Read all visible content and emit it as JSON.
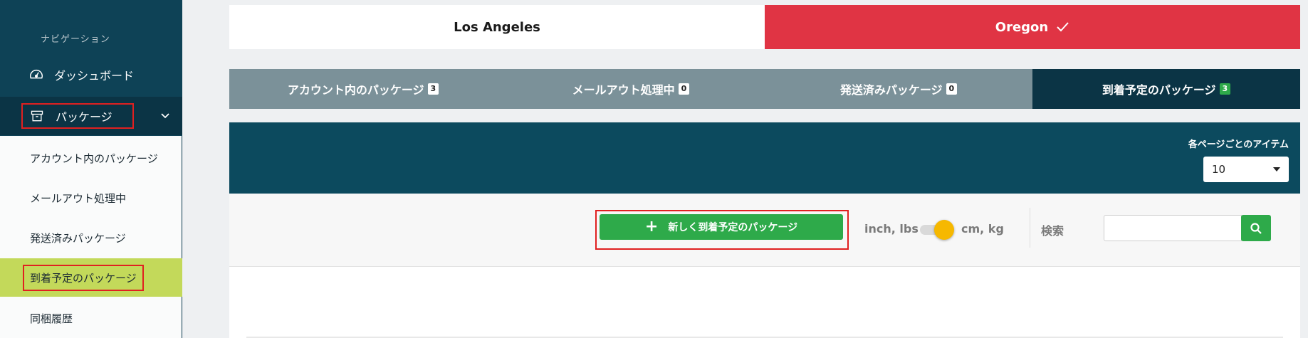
{
  "sidebar": {
    "heading": "ナビゲーション",
    "dashboard": "ダッシュボード",
    "packages": "パッケージ",
    "sub_items": [
      "アカウント内のパッケージ",
      "メールアウト処理中",
      "発送済みパッケージ",
      "到着予定のパッケージ",
      "同梱履歴"
    ],
    "active_sub_item": "到着予定のパッケージ"
  },
  "locations": {
    "tabs": [
      "Los Angeles",
      "Oregon"
    ],
    "selected": "Oregon"
  },
  "status_tabs": [
    {
      "label": "アカウント内のパッケージ",
      "count": "3"
    },
    {
      "label": "メールアウト処理中",
      "count": "0"
    },
    {
      "label": "発送済みパッケージ",
      "count": "0"
    },
    {
      "label": "到着予定のパッケージ",
      "count": "3"
    }
  ],
  "active_status_tab": "到着予定のパッケージ",
  "pagination": {
    "items_per_page_label": "各ページごとのアイテム",
    "items_per_page_value": "10"
  },
  "toolbar": {
    "new_button_label": "新しく到着予定のパッケージ",
    "unit_left": "inch, lbs",
    "unit_right": "cm, kg",
    "unit_selected": "cm, kg",
    "search_label": "検索",
    "search_value": ""
  },
  "colors": {
    "sidebar_dark": "#0e4256",
    "active_sub_bg": "#c3d95a",
    "oregon_red": "#e03444",
    "tab_gray": "#7b9199",
    "tab_active": "#0b3445",
    "panel": "#0c4a5e",
    "green": "#2eaa4a",
    "toggle_knob": "#f6b800",
    "highlight_border": "#e02020"
  },
  "icons": {
    "dashboard": "gauge-icon",
    "packages": "archive-box-icon",
    "expand": "chevron-down-icon",
    "selected": "check-icon",
    "add": "plus-icon",
    "search": "search-icon",
    "select_caret": "caret-down-icon"
  }
}
